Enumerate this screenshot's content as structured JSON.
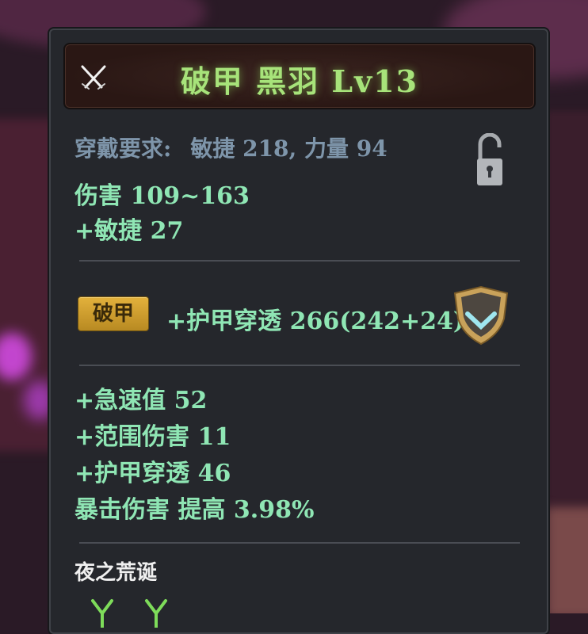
{
  "item": {
    "title": "破甲  黑羽  Lv13",
    "title_color": "#a7e37a",
    "type_icon": "crossed-swords-icon"
  },
  "requirement": {
    "label": "穿戴要求:",
    "value": "敏捷 218, 力量 94",
    "lock_icon": "padlock-unlocked-icon"
  },
  "base_stats": [
    "伤害   109~163",
    "+敏捷  27"
  ],
  "special": {
    "badge": "破甲",
    "text": "+护甲穿透  266(242+24)",
    "icon": "shield-rank-icon"
  },
  "bonus_stats": [
    "+急速值  52",
    "+范围伤害  11",
    "+护甲穿透  46",
    "暴击伤害  提高  3.98%"
  ],
  "set": {
    "title": "夜之荒诞",
    "icons": [
      "green-chevron-icon",
      "green-chevron-icon"
    ]
  },
  "colors": {
    "stat": "#8fe6b4",
    "requirement": "#7e95aa",
    "badge": "#d9a832",
    "panel_bg": "#25272c"
  }
}
